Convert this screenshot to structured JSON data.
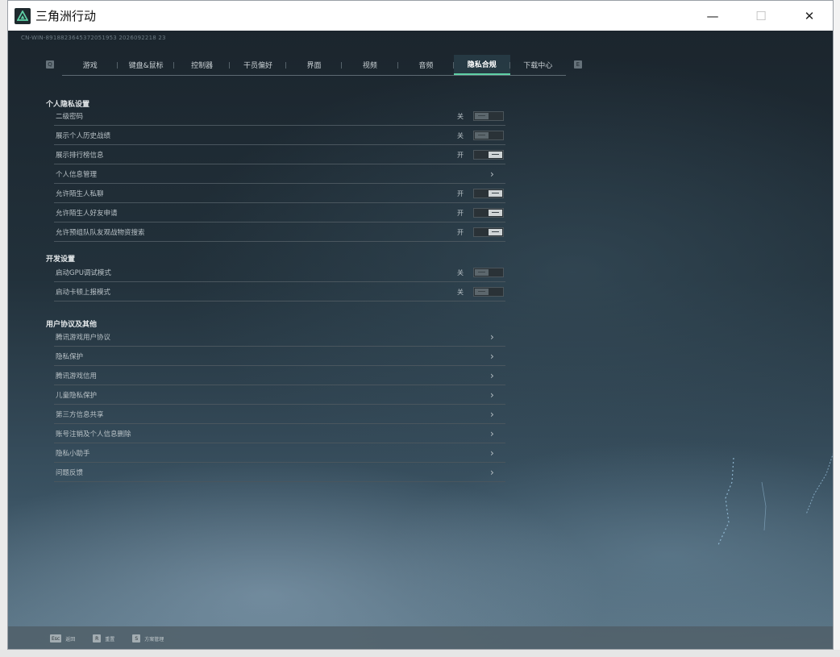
{
  "window": {
    "title": "三角洲行动",
    "controls": {
      "minimize": "—",
      "maximize": "☐",
      "close": "✕"
    }
  },
  "build_id": "CN-WIN-8918823645372051953 2026092218 23",
  "tab_keys": {
    "prev": "Q",
    "next": "E"
  },
  "tabs": [
    {
      "label": "游戏",
      "active": false
    },
    {
      "label": "键盘&鼠标",
      "active": false
    },
    {
      "label": "控制器",
      "active": false
    },
    {
      "label": "干员偏好",
      "active": false
    },
    {
      "label": "界面",
      "active": false
    },
    {
      "label": "视频",
      "active": false
    },
    {
      "label": "音频",
      "active": false
    },
    {
      "label": "隐私合规",
      "active": true
    },
    {
      "label": "下载中心",
      "active": false
    }
  ],
  "sections": {
    "privacy": {
      "title": "个人隐私设置",
      "rows": [
        {
          "label": "二级密码",
          "state": "关",
          "type": "toggle",
          "on": false
        },
        {
          "label": "展示个人历史战绩",
          "state": "关",
          "type": "toggle",
          "on": false
        },
        {
          "label": "展示排行榜信息",
          "state": "开",
          "type": "toggle",
          "on": true
        },
        {
          "label": "个人信息管理",
          "state": "",
          "type": "link"
        },
        {
          "label": "允许陌生人私聊",
          "state": "开",
          "type": "toggle",
          "on": true
        },
        {
          "label": "允许陌生人好友申请",
          "state": "开",
          "type": "toggle",
          "on": true
        },
        {
          "label": "允许预组队队友观战物资搜索",
          "state": "开",
          "type": "toggle",
          "on": true
        }
      ]
    },
    "dev": {
      "title": "开发设置",
      "rows": [
        {
          "label": "启动GPU调试模式",
          "state": "关",
          "type": "toggle",
          "on": false
        },
        {
          "label": "启动卡顿上报模式",
          "state": "关",
          "type": "toggle",
          "on": false
        }
      ]
    },
    "agreements": {
      "title": "用户协议及其他",
      "rows": [
        {
          "label": "腾讯游戏用户协议",
          "type": "link"
        },
        {
          "label": "隐私保护",
          "type": "link"
        },
        {
          "label": "腾讯游戏信用",
          "type": "link"
        },
        {
          "label": "儿童隐私保护",
          "type": "link"
        },
        {
          "label": "第三方信息共享",
          "type": "link"
        },
        {
          "label": "账号注销及个人信息删除",
          "type": "link"
        },
        {
          "label": "隐私小助手",
          "type": "link"
        },
        {
          "label": "问题反馈",
          "type": "link"
        }
      ]
    }
  },
  "hints": [
    {
      "key": "Esc",
      "label": "返回"
    },
    {
      "key": "R",
      "label": "重置"
    },
    {
      "key": "S",
      "label": "方案管理"
    }
  ],
  "colors": {
    "accent": "#5fd1a6",
    "panel": "#1c2730"
  }
}
